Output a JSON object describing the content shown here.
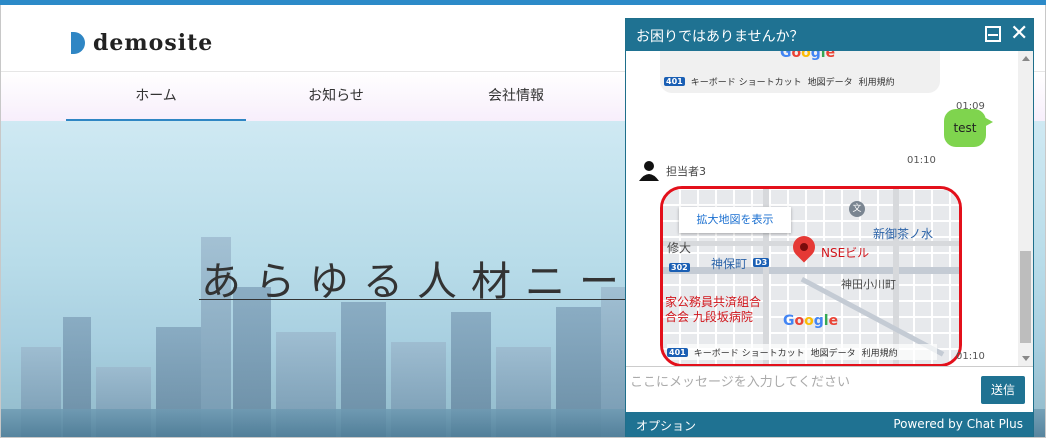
{
  "site": {
    "logo_text": "demosite",
    "nav": [
      "ホーム",
      "お知らせ",
      "会社情報"
    ],
    "hero_title": "あらゆる人材ニー"
  },
  "chat": {
    "title": "お困りではありませんか？",
    "messages": [
      {
        "type": "map",
        "footer": [
          "401",
          "キーボード ショートカット",
          "地図データ",
          "利用規約"
        ],
        "time": "01:09"
      },
      {
        "type": "user",
        "text": "test",
        "time": "01:10"
      },
      {
        "type": "agent",
        "name": "担当者3"
      },
      {
        "type": "map",
        "time": "01:10"
      }
    ],
    "map": {
      "enlarge_label": "拡大地図を表示",
      "place_name": "NSEビル",
      "labels": {
        "jinbocho": "神保町",
        "kanda_ogawamachi": "神田小川町",
        "shin_ochanomizu": "新御茶ノ水",
        "shu_dai": "修大",
        "kumiai1": "家公務員共済組合",
        "kumiai2": "合会 九段坂病院",
        "route302": "302",
        "route401": "401",
        "metro_sign": "D3",
        "poi_icon": "文"
      },
      "footer": [
        "キーボード ショートカット",
        "地図データ",
        "利用規約"
      ],
      "google": "Google"
    },
    "input_placeholder": "ここにメッセージを入力してください",
    "send_label": "送信",
    "footer_option": "オプション",
    "footer_powered": "Powered by Chat Plus"
  }
}
